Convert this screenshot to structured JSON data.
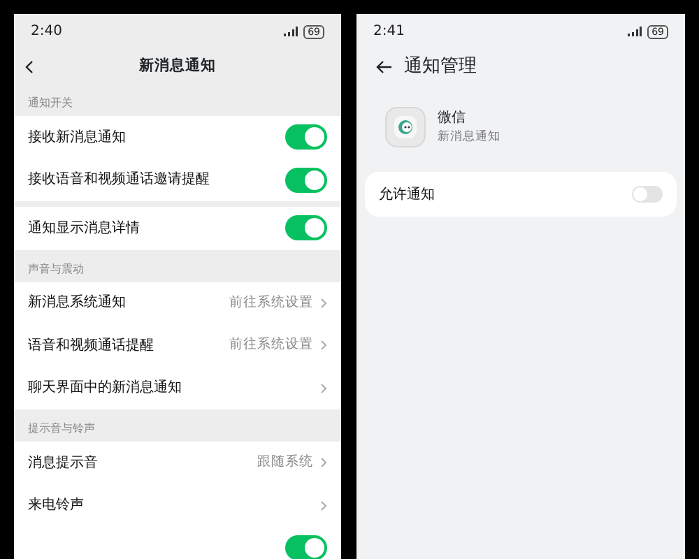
{
  "left_screen": {
    "status_bar": {
      "time": "2:40",
      "battery": "69"
    },
    "title": "新消息通知",
    "sections": [
      {
        "label": "通知开关",
        "groups": [
          [
            {
              "kind": "toggle",
              "label": "接收新消息通知",
              "on": true
            },
            {
              "kind": "toggle",
              "label": "接收语音和视频通话邀请提醒",
              "on": true
            }
          ],
          [
            {
              "kind": "toggle",
              "label": "通知显示消息详情",
              "on": true
            }
          ]
        ]
      },
      {
        "label": "声音与震动",
        "groups": [
          [
            {
              "kind": "link",
              "label": "新消息系统通知",
              "value": "前往系统设置"
            },
            {
              "kind": "link",
              "label": "语音和视频通话提醒",
              "value": "前往系统设置"
            },
            {
              "kind": "link",
              "label": "聊天界面中的新消息通知"
            }
          ]
        ]
      },
      {
        "label": "提示音与铃声",
        "groups": [
          [
            {
              "kind": "link",
              "label": "消息提示音",
              "value": "跟随系统"
            },
            {
              "kind": "link",
              "label": "来电铃声"
            },
            {
              "kind": "toggle",
              "on": true
            }
          ]
        ]
      }
    ]
  },
  "right_screen": {
    "status_bar": {
      "time": "2:41",
      "battery": "69"
    },
    "title": "通知管理",
    "app": {
      "name": "微信",
      "subtitle": "新消息通知"
    },
    "settings": [
      {
        "kind": "toggle",
        "label": "允许通知",
        "on": false
      }
    ]
  }
}
